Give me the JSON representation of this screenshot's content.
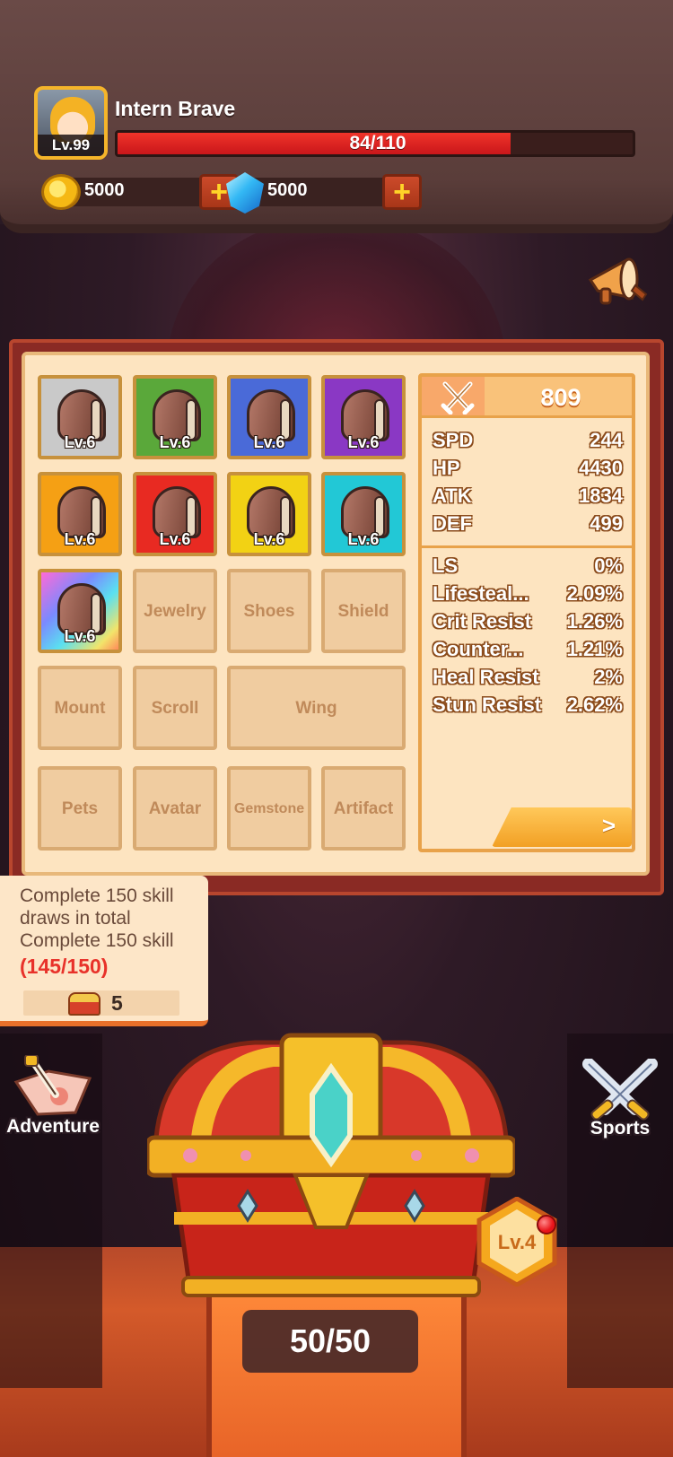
{
  "player": {
    "name": "Intern Brave",
    "level_label": "Lv.99",
    "hp_text": "84/110",
    "hp_current": 84,
    "hp_max": 110
  },
  "currencies": {
    "gold": "5000",
    "gems": "5000"
  },
  "equipment": {
    "filled_slots": [
      {
        "level": "Lv.6",
        "rarity_color": "#c9c9c9"
      },
      {
        "level": "Lv.6",
        "rarity_color": "#5aa83a"
      },
      {
        "level": "Lv.6",
        "rarity_color": "#4a6ad8"
      },
      {
        "level": "Lv.6",
        "rarity_color": "#8a38c4"
      },
      {
        "level": "Lv.6",
        "rarity_color": "#f5a014"
      },
      {
        "level": "Lv.6",
        "rarity_color": "#e82a22"
      },
      {
        "level": "Lv.6",
        "rarity_color": "#f2d214"
      },
      {
        "level": "Lv.6",
        "rarity_color": "#22c8d6"
      },
      {
        "level": "Lv.6",
        "rarity_color": "rainbow"
      }
    ],
    "empty_slots": [
      "Jewelry",
      "Shoes",
      "Shield",
      "Mount",
      "Scroll",
      "Wing",
      "Pets",
      "Avatar",
      "Gemstone",
      "Artifact"
    ]
  },
  "stats": {
    "power": "809",
    "main": [
      {
        "key": "SPD",
        "value": "244"
      },
      {
        "key": "HP",
        "value": "4430"
      },
      {
        "key": "ATK",
        "value": "1834"
      },
      {
        "key": "DEF",
        "value": "499"
      }
    ],
    "secondary": [
      {
        "key": "LS",
        "value": "0%"
      },
      {
        "key": "Lifesteal...",
        "value": "2.09%"
      },
      {
        "key": "Crit Resist",
        "value": "1.26%"
      },
      {
        "key": "Counter...",
        "value": "1.21%"
      },
      {
        "key": "Heal Resist",
        "value": "2%"
      },
      {
        "key": "Stun Resist",
        "value": "2.62%"
      }
    ],
    "detail_arrow": ">"
  },
  "quest": {
    "text": "Complete 150 skill draws in total Complete 150 skill",
    "progress": "(145/150)",
    "reward_count": "5"
  },
  "side": {
    "left_label": "Adventure",
    "right_label": "Sports"
  },
  "chest": {
    "level": "Lv.4",
    "count": "50/50"
  },
  "icons": {
    "avatar": "hero-portrait-icon",
    "gold": "gold-coin-icon",
    "gems": "blue-gem-icon",
    "plus": "plus-icon",
    "announcement": "megaphone-icon",
    "power": "crossed-swords-icon",
    "adventure": "map-sword-icon",
    "sports": "crossed-swords-icon",
    "reward": "treasure-chest-icon"
  }
}
